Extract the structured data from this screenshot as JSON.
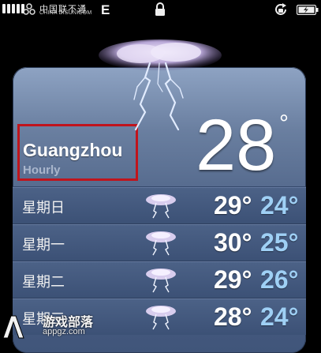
{
  "status_bar": {
    "carrier_cn": "中国联不通",
    "carrier_en": "CHINA DISUNICOM",
    "network": "E"
  },
  "weather": {
    "city": "Guangzhou",
    "subtitle": "Hourly",
    "current_temp": "28",
    "degree_symbol": "°",
    "condition_icon": "thunderstorm-icon",
    "forecast": [
      {
        "day": "星期日",
        "high": "29°",
        "low": "24°",
        "icon": "thunderstorm-icon"
      },
      {
        "day": "星期一",
        "high": "30°",
        "low": "25°",
        "icon": "thunderstorm-icon"
      },
      {
        "day": "星期二",
        "high": "29°",
        "low": "26°",
        "icon": "thunderstorm-icon"
      },
      {
        "day": "星期三",
        "high": "28°",
        "low": "24°",
        "icon": "thunderstorm-icon"
      }
    ]
  },
  "watermark": {
    "text": "游戏部落",
    "url": "appgz.com"
  },
  "colors": {
    "card_top": "#8ea3c3",
    "card_bottom": "#40557a",
    "low_temp": "#9fd0f5",
    "highlight_box": "#c0141c"
  }
}
